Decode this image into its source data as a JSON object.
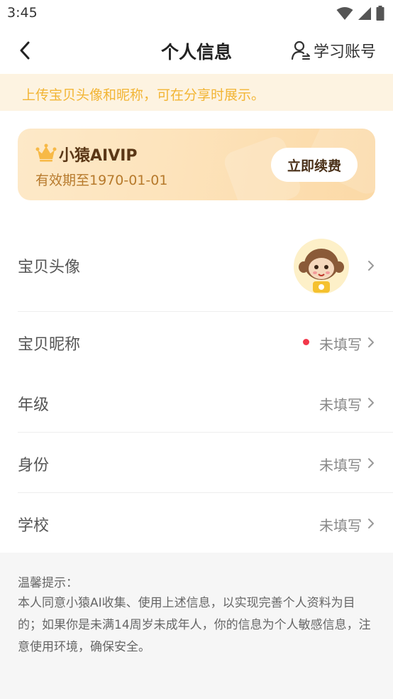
{
  "status_bar": {
    "time": "3:45"
  },
  "header": {
    "title": "个人信息",
    "account_label": "学习账号"
  },
  "tip": "上传宝贝头像和昵称，可在分享时展示。",
  "vip": {
    "title": "小猿AIVIP",
    "expiry": "有效期至1970-01-01",
    "renew_label": "立即续费"
  },
  "profile_rows": {
    "avatar": {
      "label": "宝贝头像"
    },
    "nickname": {
      "label": "宝贝昵称",
      "value": "未填写"
    },
    "grade": {
      "label": "年级",
      "value": "未填写"
    },
    "identity": {
      "label": "身份",
      "value": "未填写"
    },
    "school": {
      "label": "学校",
      "value": "未填写"
    }
  },
  "notice": {
    "title": "温馨提示：",
    "body": "本人同意小猿AI收集、使用上述信息，以实现完善个人资料为目的；如果你是未满14周岁未成年人，你的信息为个人敏感信息，注意使用环境，确保安全。"
  },
  "colors": {
    "accent": "#f2b535",
    "tip_bg": "#fdf3e1",
    "dot_red": "#f2374a",
    "vip_text": "#b77a2c"
  },
  "icons": [
    "wifi-icon",
    "signal-icon",
    "battery-icon",
    "back-arrow-icon",
    "account-switch-icon",
    "crown-icon",
    "chevron-right-icon"
  ]
}
